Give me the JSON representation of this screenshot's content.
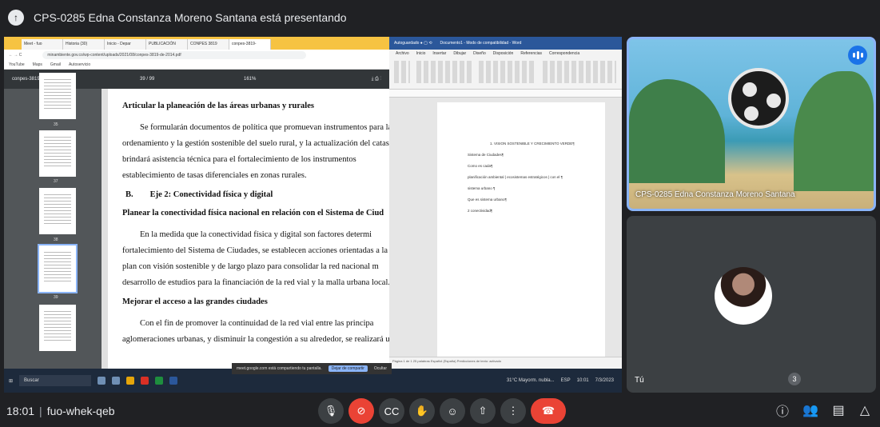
{
  "banner": {
    "icon": "present-to-all-icon",
    "text": "CPS-0285 Edna Constanza Moreno Santana está presentando"
  },
  "browser": {
    "tabs": [
      "Meet - fuo",
      "Historia (30)",
      "Inicio - Depar",
      "PUBLICACIÓN",
      "CONPES 3819",
      "conpes-3819-"
    ],
    "url": "minambiente.gov.co/wp-content/uploads/2021/08/conpes-3819-de-2014.pdf",
    "bookmarks": [
      "YouTube",
      "Maps",
      "Gmail",
      "Autoservicio"
    ],
    "pdf_title": "conpes-3819-de-2014.pdf",
    "pdf_pages": "39 / 99",
    "pdf_zoom": "161%",
    "thumb_numbers": [
      "35",
      "37",
      "38",
      "39"
    ]
  },
  "pdf": {
    "line1": "Articular la planeación de las áreas urbanas y rurales",
    "p1": [
      "Se formularán documentos de política que promuevan instrumentos para la",
      "ordenamiento y la gestión sostenible del suelo rural, y la actualización del catast",
      "brindará asistencia técnica para el fortalecimiento de los instrumentos",
      "establecimiento de tasas diferenciales en zonas rurales."
    ],
    "heading_b": "B.        Eje 2: Conectividad física y digital",
    "heading_plan": "Planear la conectividad física nacional en relación con el Sistema de Ciud",
    "p2": [
      "En la medida que la conectividad física y digital son factores determi",
      "fortalecimiento del Sistema de Ciudades, se establecen acciones orientadas a la for",
      "plan con visión sostenible y de largo plazo para consolidar la red nacional m",
      "desarrollo de estudios para la financiación de la red vial y la malla urbana local."
    ],
    "heading_access": "Mejorar el acceso a las grandes ciudades",
    "p3": [
      "Con el fin de promover la continuidad de la red vial entre las principa",
      "aglomeraciones urbanas, y disminuir la congestión a su alrededor, se realizará u"
    ]
  },
  "word": {
    "title": "Documento1 - Modo de compatibilidad - Word",
    "menu": [
      "Archivo",
      "Inicio",
      "Insertar",
      "Dibujar",
      "Diseño",
      "Disposición",
      "Referencias",
      "Correspondencia",
      "Revi"
    ],
    "lines": [
      "1.  VISION SOSTENIBLE Y CRECIMIENTO VERDE¶",
      "Sistema de Ciudades¶",
      "Como es cada¶",
      "planificación ambiental | ecosistemas estratégicos | con el ¶",
      "sistema urbano ¶",
      "Que es sistema urbano¶",
      "2 conectividad¶"
    ],
    "status": "Página 1 de 1   25 palabras   Español (España)   Predicciones de texto: activado"
  },
  "taskbar": {
    "search": "Buscar",
    "weather": "31°C  Mayorm. nubla...",
    "time": "10:01",
    "date": "7/3/2023",
    "lang": "ESP"
  },
  "share_toast": {
    "text": "meet.google.com está compartiendo tu pantalla.",
    "stop": "Dejar de compartir",
    "hide": "Ocultar"
  },
  "tiles": {
    "presenter_name": "CPS-0285 Edna Constanza Moreno Santana",
    "self_name": "Tú"
  },
  "controls": {
    "time": "18:01",
    "code": "fuo-whek-qeb",
    "participants_count": "3"
  }
}
